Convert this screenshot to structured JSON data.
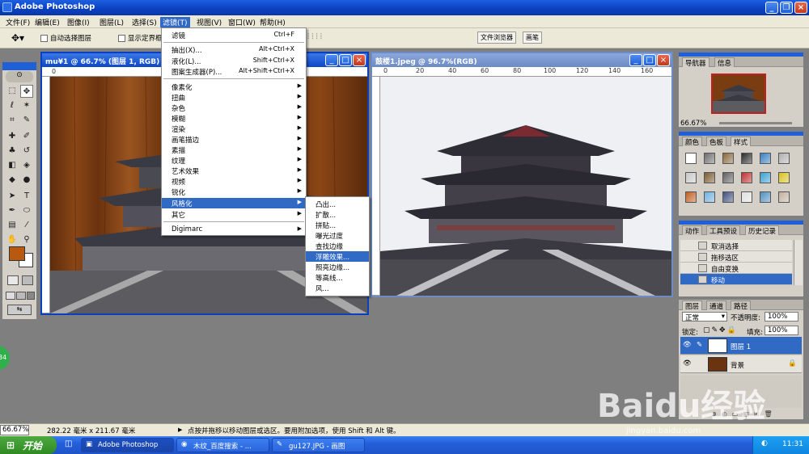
{
  "app": {
    "title": "Adobe Photoshop"
  },
  "menubar": {
    "items": [
      "文件(F)",
      "编辑(E)",
      "图像(I)",
      "图层(L)",
      "选择(S)",
      "滤镜(T)",
      "视图(V)",
      "窗口(W)",
      "帮助(H)"
    ],
    "active": "滤镜(T)"
  },
  "options": {
    "auto_select": "自动选择图层",
    "show_bounds": "显示定界框",
    "tab_file_browser": "文件浏览器",
    "tab_brushes": "画笔"
  },
  "doc1": {
    "title": "mu¥1 @ 66.7% (图层 1, RGB)",
    "ruler_marks": [
      "0"
    ],
    "wood_color": "#7a3d12"
  },
  "doc2": {
    "title": "鼓楼1.jpeg @ 96.7%(RGB)",
    "ruler_marks": [
      "0",
      "20",
      "40",
      "60",
      "80",
      "100",
      "120",
      "140",
      "160"
    ]
  },
  "filter_menu": {
    "top": [
      {
        "label": "滤镜",
        "shortcut": "Ctrl+F"
      }
    ],
    "group2": [
      {
        "label": "抽出(X)...",
        "shortcut": "Alt+Ctrl+X"
      },
      {
        "label": "液化(L)...",
        "shortcut": "Shift+Ctrl+X"
      },
      {
        "label": "图案生成器(P)...",
        "shortcut": "Alt+Shift+Ctrl+X"
      }
    ],
    "submenus": [
      "像素化",
      "扭曲",
      "杂色",
      "模糊",
      "渲染",
      "画笔描边",
      "素描",
      "纹理",
      "艺术效果",
      "视频",
      "锐化",
      "风格化",
      "其它"
    ],
    "highlighted": "风格化",
    "digimarc": "Digimarc"
  },
  "stylize_menu": {
    "items": [
      "凸出...",
      "扩散...",
      "拼贴...",
      "曝光过度",
      "查找边缘",
      "浮雕效果...",
      "照亮边缘...",
      "等高线...",
      "风..."
    ],
    "highlighted": "浮雕效果..."
  },
  "navigator": {
    "tabs": [
      "导航器",
      "信息"
    ],
    "zoom": "66.67%"
  },
  "swatches_panel": {
    "tabs": [
      "颜色",
      "色板",
      "样式"
    ],
    "colors": [
      "#ffffff",
      "#6e6e6e",
      "#8a6a3c",
      "#2a2a2a",
      "#3a7fc0",
      "#b0b0b0",
      "#c8c8c8",
      "#7a5a30",
      "#606060",
      "#c03030",
      "#3aa0d0",
      "#d8c020",
      "#c06020",
      "#70b0e0",
      "#405080",
      "#e0e0e0",
      "#5090c0",
      "#c0b0a0"
    ]
  },
  "history_panel": {
    "tabs": [
      "动作",
      "工具预设",
      "历史记录"
    ],
    "items": [
      "取消选择",
      "拖移选区",
      "自由变换",
      "移动"
    ],
    "selected": "移动"
  },
  "layers_panel": {
    "tabs": [
      "图层",
      "通道",
      "路径"
    ],
    "blend_mode": "正常",
    "opacity_label": "不透明度:",
    "opacity": "100%",
    "lock_label": "锁定:",
    "fill_label": "填充:",
    "fill": "100%",
    "layers": [
      {
        "name": "图层 1",
        "selected": true
      },
      {
        "name": "背景",
        "selected": false
      }
    ]
  },
  "statusbar": {
    "zoom": "66.67%",
    "size": "282.22 毫米 x 211.67 毫米",
    "hint": "点按并拖移以移动图层或选区。要用附加选项，使用 Shift 和 Alt 键。"
  },
  "taskbar": {
    "start": "开始",
    "buttons": [
      "Adobe Photoshop",
      "木纹_百度搜索 - ...",
      "gu127.JPG - 画图"
    ],
    "clock": "11:31"
  },
  "watermark": {
    "text": "Baidu经验",
    "url": "jingyan.baidu.com"
  },
  "badge": {
    "text": "34"
  }
}
